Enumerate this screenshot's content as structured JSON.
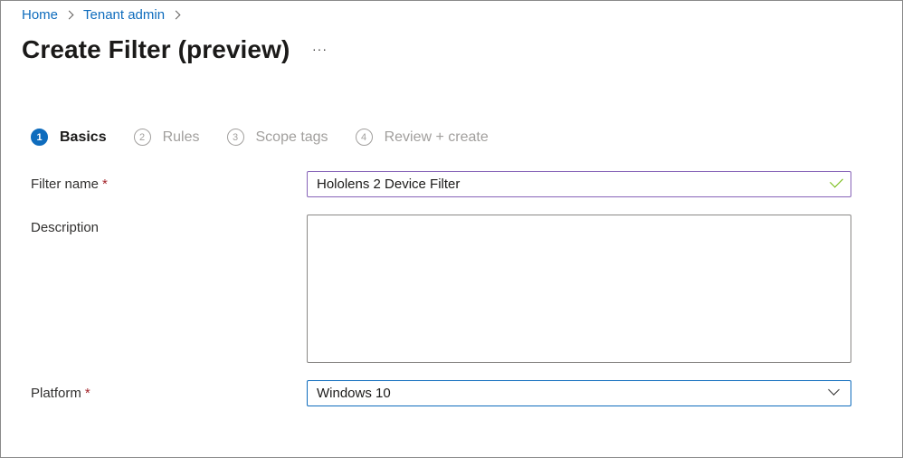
{
  "breadcrumb": {
    "items": [
      "Home",
      "Tenant admin"
    ],
    "icon": "chevron-right-icon"
  },
  "header": {
    "title": "Create Filter (preview)",
    "more": "···"
  },
  "wizard": {
    "steps": [
      {
        "number": "1",
        "label": "Basics",
        "active": true
      },
      {
        "number": "2",
        "label": "Rules",
        "active": false
      },
      {
        "number": "3",
        "label": "Scope tags",
        "active": false
      },
      {
        "number": "4",
        "label": "Review + create",
        "active": false
      }
    ]
  },
  "form": {
    "filter_name": {
      "label": "Filter name",
      "required_mark": "*",
      "value": "Hololens 2 Device Filter",
      "valid_icon": "checkmark-icon"
    },
    "description": {
      "label": "Description",
      "value": ""
    },
    "platform": {
      "label": "Platform",
      "required_mark": "*",
      "value": "Windows 10",
      "icon": "chevron-down-icon"
    }
  },
  "colors": {
    "link": "#0f6cbd",
    "accent": "#0f6cbd",
    "required": "#a4262c",
    "valid": "#6bb700",
    "name_input_border": "#8764b8"
  }
}
